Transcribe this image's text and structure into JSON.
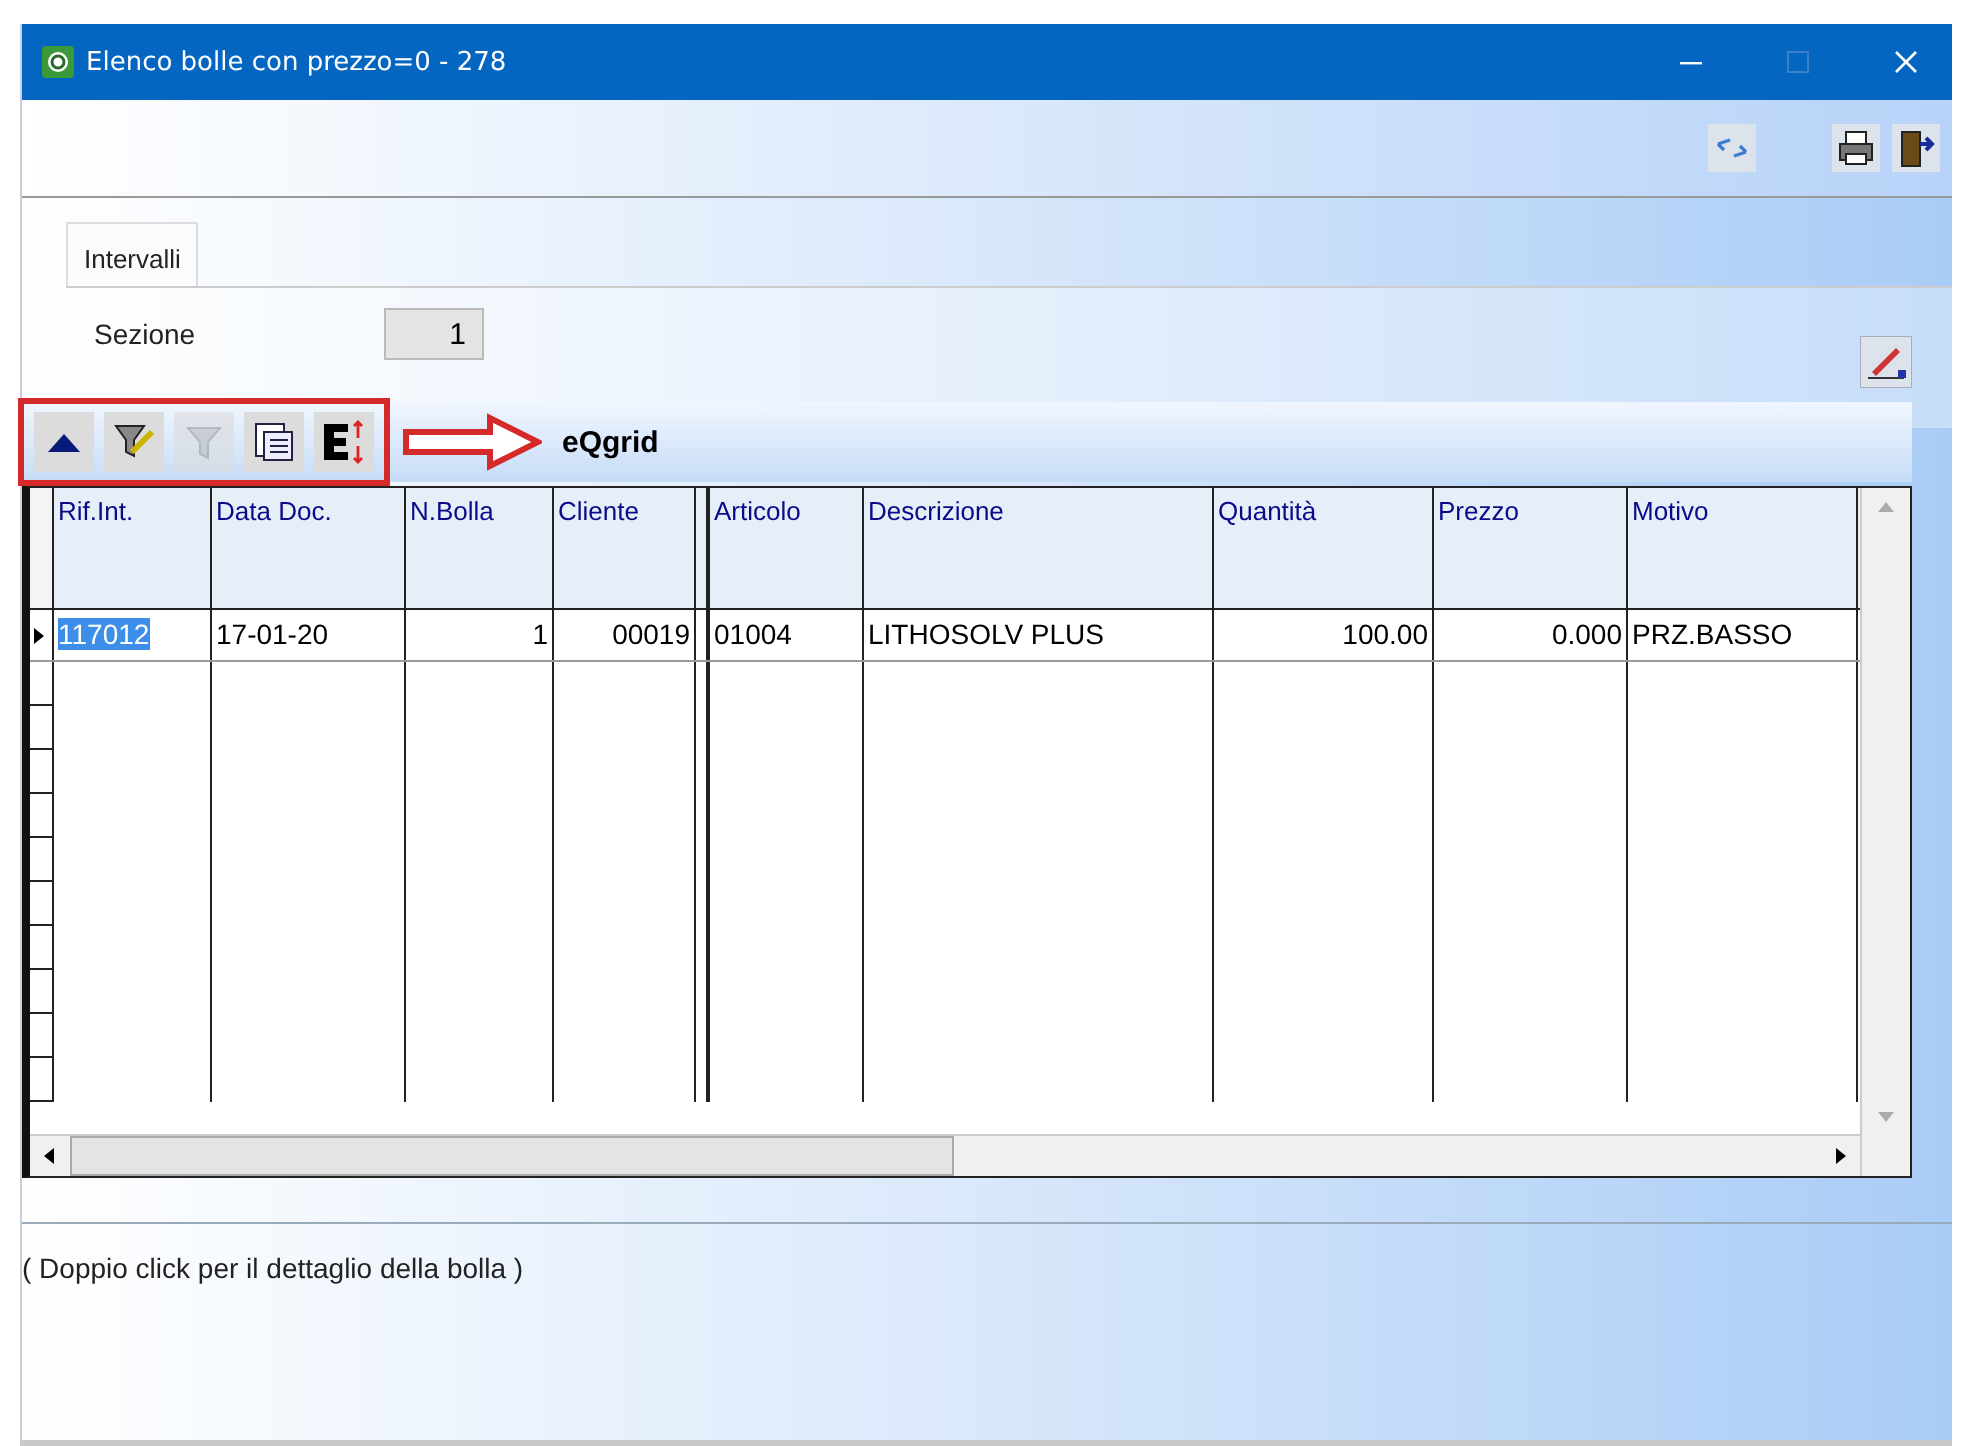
{
  "window": {
    "title": "Elenco bolle con prezzo=0 - 278"
  },
  "tabs": [
    {
      "label": "Intervalli",
      "selected": true
    }
  ],
  "fields": [
    {
      "label": "Sezione",
      "value": "1"
    }
  ],
  "grid_toolbar": {
    "buttons": [
      {
        "kind": "up",
        "disabled": false
      },
      {
        "kind": "filter-edit",
        "disabled": false
      },
      {
        "kind": "filter",
        "disabled": true
      },
      {
        "kind": "columns",
        "disabled": false
      },
      {
        "kind": "export",
        "disabled": false
      }
    ],
    "title": "eQgrid"
  },
  "table": {
    "columns": [
      {
        "label": "Rif.Int."
      },
      {
        "label": "Data Doc."
      },
      {
        "label": "N.Bolla"
      },
      {
        "label": "Cliente"
      },
      {
        "label": "Articolo"
      },
      {
        "label": "Descrizione"
      },
      {
        "label": "Quantità"
      },
      {
        "label": "Prezzo"
      },
      {
        "label": "Motivo"
      }
    ],
    "rows": [
      {
        "selected": true,
        "cells": [
          "117012",
          "17-01-20",
          "1",
          "00019",
          "01004",
          "LITHOSOLV PLUS",
          "100.00",
          "0.000",
          "PRZ.BASSO"
        ]
      }
    ]
  },
  "status_bar": {
    "text": "( Doppio click per il dettaglio della bolla )"
  }
}
